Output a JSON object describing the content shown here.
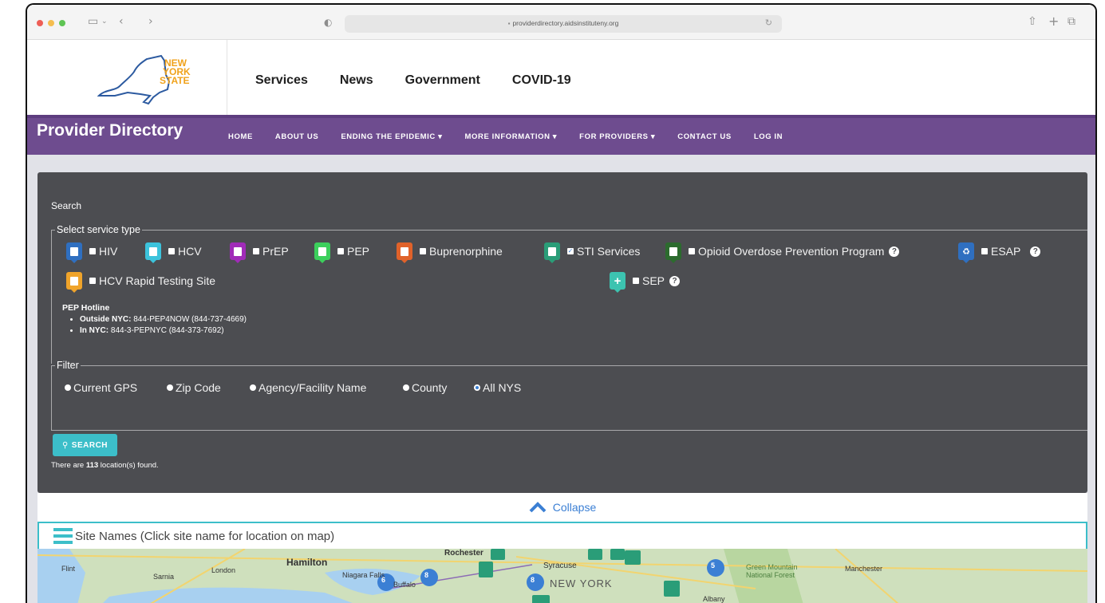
{
  "browser": {
    "url": "providerdirectory.aidsinstituteny.org"
  },
  "nys_header": {
    "logo_text": [
      "NEW",
      "YORK",
      "STATE"
    ],
    "nav": [
      "Services",
      "News",
      "Government",
      "COVID-19"
    ]
  },
  "site_nav": {
    "title": "Provider Directory",
    "items": [
      "HOME",
      "ABOUT US",
      "ENDING THE EPIDEMIC ▾",
      "MORE INFORMATION ▾",
      "FOR PROVIDERS ▾",
      "CONTACT US",
      "LOG IN"
    ]
  },
  "search": {
    "heading": "Search",
    "service_legend": "Select service type",
    "services": [
      {
        "label": "HIV",
        "checked": false,
        "color": "#2f6fc0"
      },
      {
        "label": "HCV",
        "checked": false,
        "color": "#3cc3dc"
      },
      {
        "label": "PrEP",
        "checked": false,
        "color": "#a02bb8"
      },
      {
        "label": "PEP",
        "checked": false,
        "color": "#3ccf5c"
      },
      {
        "label": "Buprenorphine",
        "checked": false,
        "color": "#e0622a"
      },
      {
        "label": "STI Services",
        "checked": true,
        "color": "#2a9d78"
      },
      {
        "label": "Opioid Overdose Prevention Program",
        "checked": false,
        "color": "#2c6b2e"
      },
      {
        "label": "ESAP",
        "checked": false,
        "color": "#2f6fc0"
      },
      {
        "label": "HCV Rapid Testing Site",
        "checked": false,
        "color": "#f0a42a"
      },
      {
        "label": "SEP",
        "checked": false,
        "color": "#3cc3b0"
      }
    ],
    "hotline": {
      "title": "PEP Hotline",
      "items": [
        {
          "label": "Outside NYC:",
          "value": "844-PEP4NOW (844-737-4669)"
        },
        {
          "label": "In NYC:",
          "value": "844-3-PEPNYC (844-373-7692)"
        }
      ]
    },
    "filter_legend": "Filter",
    "filters": [
      {
        "label": "Current GPS",
        "selected": false
      },
      {
        "label": "Zip Code",
        "selected": false
      },
      {
        "label": "Agency/Facility Name",
        "selected": false
      },
      {
        "label": "County",
        "selected": false
      },
      {
        "label": "All NYS",
        "selected": true
      }
    ],
    "button_label": "SEARCH",
    "results_prefix": "There are",
    "results_count": "113",
    "results_suffix": "location(s) found."
  },
  "collapse_label": "Collapse",
  "site_names_label": "Site Names (Click site name for location on map)",
  "map": {
    "labels": [
      "Flint",
      "Sarnia",
      "London",
      "Hamilton",
      "Niagara Falls",
      "Rochester",
      "Syracuse",
      "NEW YORK",
      "Green Mountain National Forest",
      "Manchester",
      "Albany",
      "Buffalo"
    ],
    "clusters": [
      "6",
      "8",
      "8",
      "5"
    ]
  }
}
